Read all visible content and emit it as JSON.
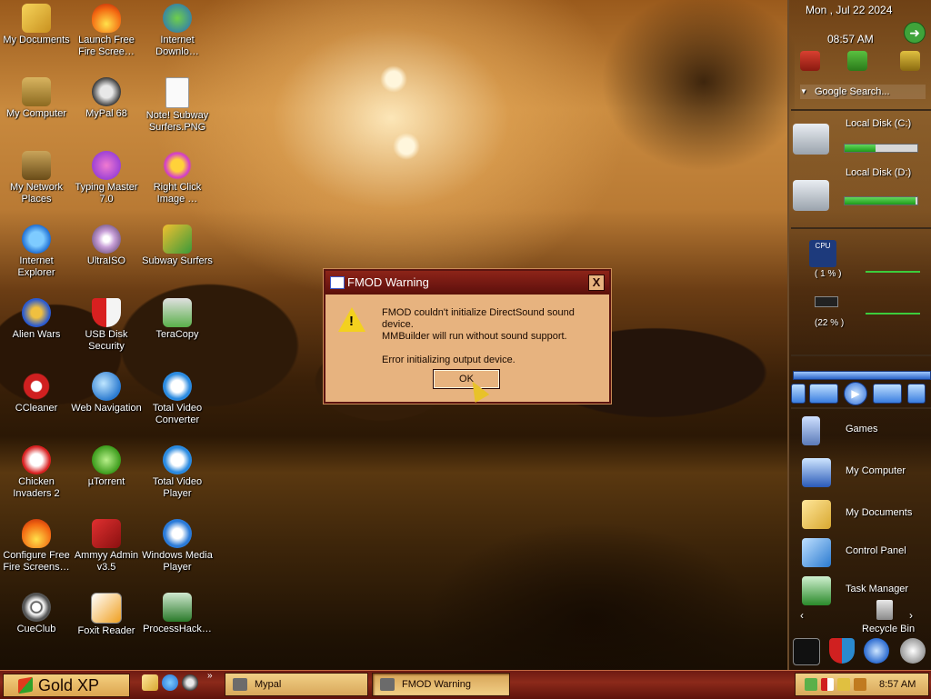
{
  "desktop_icons": [
    {
      "label": "My Documents",
      "icon": "folder-documents-icon"
    },
    {
      "label": "Launch Free Fire Scree…",
      "icon": "fire-icon"
    },
    {
      "label": "Internet Downlo…",
      "icon": "internet-download-manager-icon"
    },
    {
      "label": "My Computer",
      "icon": "computer-icon"
    },
    {
      "label": "MyPal 68",
      "icon": "raccoon-browser-icon"
    },
    {
      "label": "Note! Subway Surfers.PNG",
      "icon": "image-file-icon"
    },
    {
      "label": "My Network Places",
      "icon": "network-places-icon"
    },
    {
      "label": "Typing Master 7.0",
      "icon": "typing-master-icon"
    },
    {
      "label": "Right Click Image …",
      "icon": "gear-flower-icon"
    },
    {
      "label": "Internet Explorer",
      "icon": "internet-explorer-icon"
    },
    {
      "label": "UltraISO",
      "icon": "disc-icon"
    },
    {
      "label": "Subway Surfers",
      "icon": "subway-surfers-icon"
    },
    {
      "label": "Alien Wars",
      "icon": "alien-wars-icon"
    },
    {
      "label": "USB Disk Security",
      "icon": "shield-icon"
    },
    {
      "label": "TeraCopy",
      "icon": "teracopy-icon"
    },
    {
      "label": "CCleaner",
      "icon": "ccleaner-icon"
    },
    {
      "label": "Web Navigation",
      "icon": "globe-icon"
    },
    {
      "label": "Total Video Converter",
      "icon": "video-converter-icon"
    },
    {
      "label": "Chicken Invaders 2",
      "icon": "chicken-icon"
    },
    {
      "label": "µTorrent",
      "icon": "utorrent-icon"
    },
    {
      "label": "Total Video Player",
      "icon": "video-player-icon"
    },
    {
      "label": "Configure Free Fire Screens…",
      "icon": "fire-icon"
    },
    {
      "label": "Ammyy Admin v3.5",
      "icon": "ammyy-admin-icon"
    },
    {
      "label": "Windows Media Player",
      "icon": "media-player-icon"
    },
    {
      "label": "CueClub",
      "icon": "cueclub-icon"
    },
    {
      "label": "Foxit Reader",
      "icon": "foxit-reader-icon"
    },
    {
      "label": "ProcessHack…",
      "icon": "process-hacker-icon"
    }
  ],
  "dialog": {
    "title": "FMOD Warning",
    "close": "X",
    "line1": "FMOD couldn't initialize DirectSound sound device.",
    "line2": "MMBuilder will run without sound support.",
    "line3": "Error initializing output device.",
    "ok": "OK",
    "icon": "warning-icon"
  },
  "sidebar": {
    "date": "Mon , Jul 22 2024",
    "time": "08:57 AM",
    "search_label": "Google Search...",
    "disks": [
      {
        "label": "Local Disk (C:)",
        "used": 0.42
      },
      {
        "label": "Local Disk (D:)",
        "used": 0.97
      }
    ],
    "cpu_label": "CPU",
    "cpu": "( 1 % )",
    "memory": "(22 % )",
    "items": [
      {
        "label": "Games",
        "icon": "games-icon"
      },
      {
        "label": "My Computer",
        "icon": "computer-icon"
      },
      {
        "label": "My Documents",
        "icon": "folder-documents-icon"
      },
      {
        "label": "Control Panel",
        "icon": "control-panel-icon"
      },
      {
        "label": "Task Manager",
        "icon": "task-manager-icon"
      }
    ],
    "recycle_bin": "Recycle Bin"
  },
  "taskbar": {
    "start_label": "Gold XP",
    "tasks": [
      {
        "label": "Mypal",
        "active": false
      },
      {
        "label": "FMOD Warning",
        "active": true
      }
    ],
    "clock": "8:57 AM"
  },
  "colors": {
    "taskbar": "#8c2a1a",
    "dialog_titlebar": "#6b1510",
    "dialog_body": "#e7b37f",
    "gold_button": "#f1cf86"
  }
}
